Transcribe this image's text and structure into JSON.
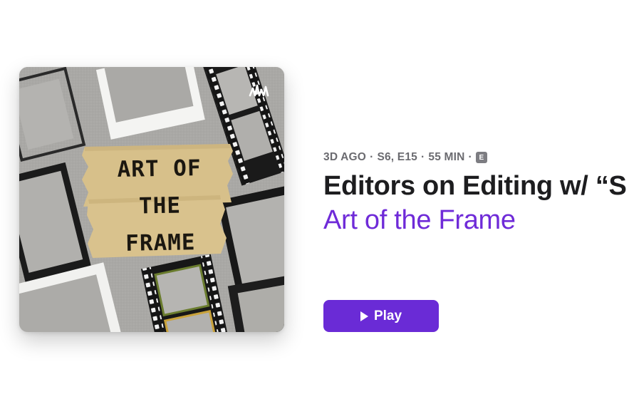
{
  "episode": {
    "meta": {
      "age": "3D AGO",
      "season_episode": "S6, E15",
      "duration": "55 MIN",
      "separator": "·",
      "explicit_label": "E"
    },
    "title": "Editors on Editing w/ “S",
    "show_name": "Art of the Frame"
  },
  "artwork": {
    "text_lines": [
      "ART OF",
      "THE",
      "FRAME"
    ],
    "badge_icon": "anchor-waveform-icon"
  },
  "actions": {
    "play_label": "Play",
    "play_icon": "play-icon"
  },
  "colors": {
    "accent": "#6a2bd6",
    "show_name": "#6f2bd8",
    "title": "#1d1d1f",
    "meta": "#6b6b70"
  }
}
